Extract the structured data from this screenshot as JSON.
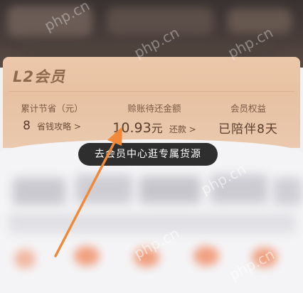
{
  "watermark": "php.cn",
  "card": {
    "title": "L2会员",
    "savings": {
      "label": "累计节省（元）",
      "value": "8",
      "link": "省钱攻略 >"
    },
    "debt": {
      "label": "赊账待还金额",
      "value": "10.93",
      "unit": "元",
      "link": "还款 >"
    },
    "rights": {
      "label": "会员权益",
      "value": "已陪伴8天"
    }
  },
  "cta": {
    "label": "去会员中心逛专属货源"
  },
  "colors": {
    "card_bg": "#e9c4a6",
    "card_text": "#5b3d2c",
    "pill_bg": "#2f2e2f",
    "arrow": "#f08a3a"
  }
}
